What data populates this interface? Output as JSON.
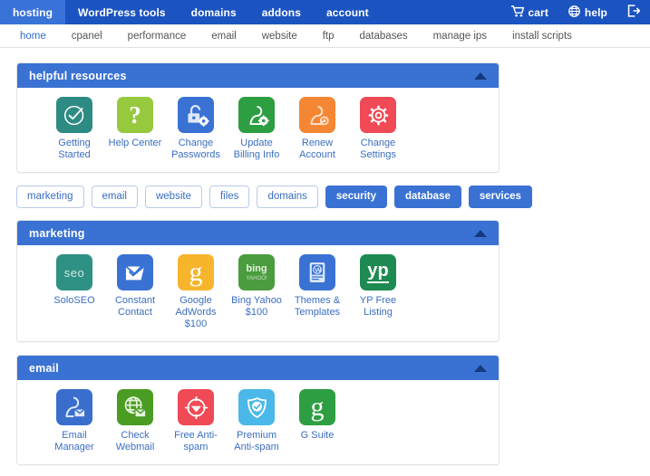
{
  "topnav": {
    "items": [
      {
        "label": "hosting",
        "active": true
      },
      {
        "label": "WordPress tools",
        "active": false
      },
      {
        "label": "domains",
        "active": false
      },
      {
        "label": "addons",
        "active": false
      },
      {
        "label": "account",
        "active": false
      }
    ],
    "right": [
      {
        "label": "cart",
        "icon": "cart-icon"
      },
      {
        "label": "help",
        "icon": "help-globe-icon"
      },
      {
        "label": "",
        "icon": "logout-icon"
      }
    ]
  },
  "subnav": {
    "items": [
      {
        "label": "home",
        "active": true
      },
      {
        "label": "cpanel",
        "active": false
      },
      {
        "label": "performance",
        "active": false
      },
      {
        "label": "email",
        "active": false
      },
      {
        "label": "website",
        "active": false
      },
      {
        "label": "ftp",
        "active": false
      },
      {
        "label": "databases",
        "active": false
      },
      {
        "label": "manage ips",
        "active": false
      },
      {
        "label": "install scripts",
        "active": false
      }
    ]
  },
  "pills": [
    {
      "label": "marketing",
      "active": false
    },
    {
      "label": "email",
      "active": false
    },
    {
      "label": "website",
      "active": false
    },
    {
      "label": "files",
      "active": false
    },
    {
      "label": "domains",
      "active": false
    },
    {
      "label": "security",
      "active": true
    },
    {
      "label": "database",
      "active": true
    },
    {
      "label": "services",
      "active": true
    }
  ],
  "panels": [
    {
      "id": "helpful-resources",
      "title": "helpful resources",
      "collapsed": false,
      "tiles": [
        {
          "label": "Getting Started",
          "icon": "check-circle-icon",
          "bg": "#2e8b84"
        },
        {
          "label": "Help Center",
          "icon": "question-mark-icon",
          "bg": "#96c93d"
        },
        {
          "label": "Change Passwords",
          "icon": "lock-gear-icon",
          "bg": "#3a72d4"
        },
        {
          "label": "Update Billing Info",
          "icon": "user-gear-icon",
          "bg": "#2e9e42"
        },
        {
          "label": "Renew Account",
          "icon": "user-renew-icon",
          "bg": "#f58634"
        },
        {
          "label": "Change Settings",
          "icon": "gear-icon",
          "bg": "#ef4a56"
        }
      ]
    },
    {
      "id": "marketing",
      "title": "marketing",
      "collapsed": false,
      "tiles": [
        {
          "label": "SoloSEO",
          "icon": "seo-icon",
          "bg": "#2e9183",
          "glyph": "seo"
        },
        {
          "label": "Constant Contact",
          "icon": "constant-contact-envelope-icon",
          "bg": "#3a72d4"
        },
        {
          "label": "Google AdWords $100",
          "icon": "google-g-icon",
          "bg": "#f7b52c",
          "glyph": "g"
        },
        {
          "label": "Bing Yahoo $100",
          "icon": "bing-yahoo-icon",
          "bg": "#4a9c3e",
          "glyph": "bing"
        },
        {
          "label": "Themes & Templates",
          "icon": "wordpress-themes-icon",
          "bg": "#3a72d4"
        },
        {
          "label": "YP Free Listing",
          "icon": "yellow-pages-icon",
          "bg": "#1d8a52",
          "glyph": "yp"
        }
      ]
    },
    {
      "id": "email",
      "title": "email",
      "collapsed": false,
      "tiles": [
        {
          "label": "Email Manager",
          "icon": "user-envelope-icon",
          "bg": "#3a6ecc"
        },
        {
          "label": "Check Webmail",
          "icon": "globe-envelope-icon",
          "bg": "#4a9c23"
        },
        {
          "label": "Free Anti-spam",
          "icon": "shield-target-icon",
          "bg": "#ef4a56"
        },
        {
          "label": "Premium Anti-spam",
          "icon": "check-shield-icon",
          "bg": "#4ab8e8"
        },
        {
          "label": "G Suite",
          "icon": "google-g-icon",
          "bg": "#2e9e42",
          "glyph": "g"
        }
      ]
    }
  ],
  "colors": {
    "topnav_bg": "#1b53c0",
    "topnav_active": "#3a73d8",
    "panel_header": "#3a72d4",
    "link": "#3a6ec0",
    "toggle_arrow": "#143a7d"
  }
}
